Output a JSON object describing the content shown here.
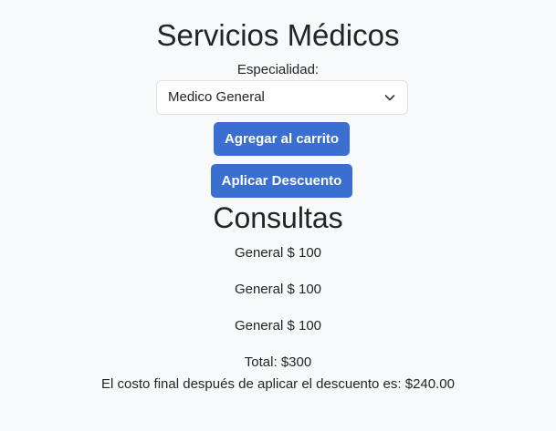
{
  "header": {
    "title": "Servicios Médicos"
  },
  "form": {
    "specialty_label": "Especialidad:",
    "specialty_selected": "Medico General"
  },
  "actions": {
    "add_to_cart_label": "Agregar al carrito",
    "apply_discount_label": "Aplicar Descuento"
  },
  "consultations": {
    "title": "Consultas",
    "items": [
      "General $ 100",
      "General $ 100",
      "General $ 100"
    ],
    "total": "Total: $300",
    "final_cost": "El costo final después de aplicar el descuento es: $240.00"
  },
  "colors": {
    "button": "#3a6fcf",
    "background": "#f8f9fa",
    "text": "#212529"
  }
}
